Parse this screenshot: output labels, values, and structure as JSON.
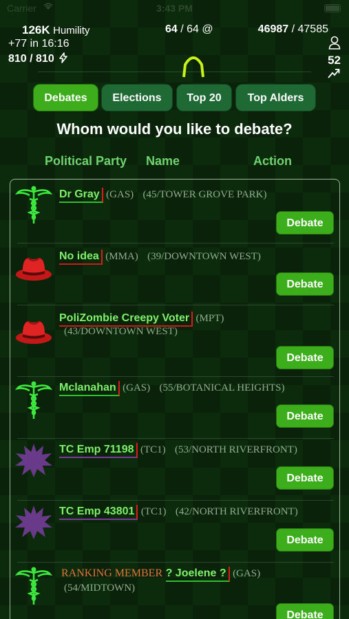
{
  "status_bar": {
    "carrier": "Carrier",
    "time": "3:43 PM"
  },
  "hud": {
    "humility_value": "126K",
    "humility_label": "Humility",
    "regen": "+77 in 16:16",
    "energy": "810 / 810",
    "action_points_current": "64",
    "action_points_rest": " / 64 @",
    "xp_current": "46987",
    "xp_rest": " / 47585",
    "level": "52"
  },
  "tabs": [
    {
      "label": "Debates",
      "active": true
    },
    {
      "label": "Elections",
      "active": false
    },
    {
      "label": "Top 20",
      "active": false
    },
    {
      "label": "Top Alders",
      "active": false
    }
  ],
  "heading": "Whom would you like to debate?",
  "columns": {
    "party": "Political Party",
    "name": "Name",
    "action": "Action"
  },
  "rows": [
    {
      "icon": "caduceus-icon",
      "name": "Dr Gray",
      "party": "(GAS)",
      "meta": "(45/TOWER GROVE PARK)",
      "meta2": "",
      "rank": "",
      "underline": "green",
      "action": "Debate"
    },
    {
      "icon": "red-fedora-icon",
      "name": "No idea",
      "party": "(MMA)",
      "meta": "(39/DOWNTOWN WEST)",
      "meta2": "",
      "rank": "",
      "underline": "red",
      "action": "Debate"
    },
    {
      "icon": "red-fedora-icon",
      "name": "PoliZombie Creepy Voter",
      "party": "(MPT)",
      "meta": "",
      "meta2": "(43/DOWNTOWN WEST)",
      "rank": "",
      "underline": "red",
      "action": "Debate"
    },
    {
      "icon": "caduceus-icon",
      "name": "Mclanahan",
      "party": "(GAS)",
      "meta": "(55/BOTANICAL HEIGHTS)",
      "meta2": "",
      "rank": "",
      "underline": "green",
      "action": "Debate"
    },
    {
      "icon": "purple-splat-icon",
      "name": "TC Emp 71198",
      "party": "(TC1)",
      "meta": "(53/NORTH RIVERFRONT)",
      "meta2": "",
      "rank": "",
      "underline": "purple",
      "action": "Debate"
    },
    {
      "icon": "purple-splat-icon",
      "name": "TC Emp 43801",
      "party": "(TC1)",
      "meta": "(42/NORTH RIVERFRONT)",
      "meta2": "",
      "rank": "",
      "underline": "purple",
      "action": "Debate"
    },
    {
      "icon": "caduceus-icon",
      "name": "? Joelene ?",
      "party": "(GAS)",
      "meta": "",
      "meta2": "(54/MIDTOWN)",
      "rank": "RANKING MEMBER",
      "underline": "green",
      "action": "Debate"
    }
  ],
  "colors": {
    "accent_green": "#3dad1c",
    "name_green": "#7ef06a",
    "rank_orange": "#e0763a",
    "caduceus": "#3fe83f",
    "fedora": "#d42020",
    "splat": "#6a3a8a"
  }
}
